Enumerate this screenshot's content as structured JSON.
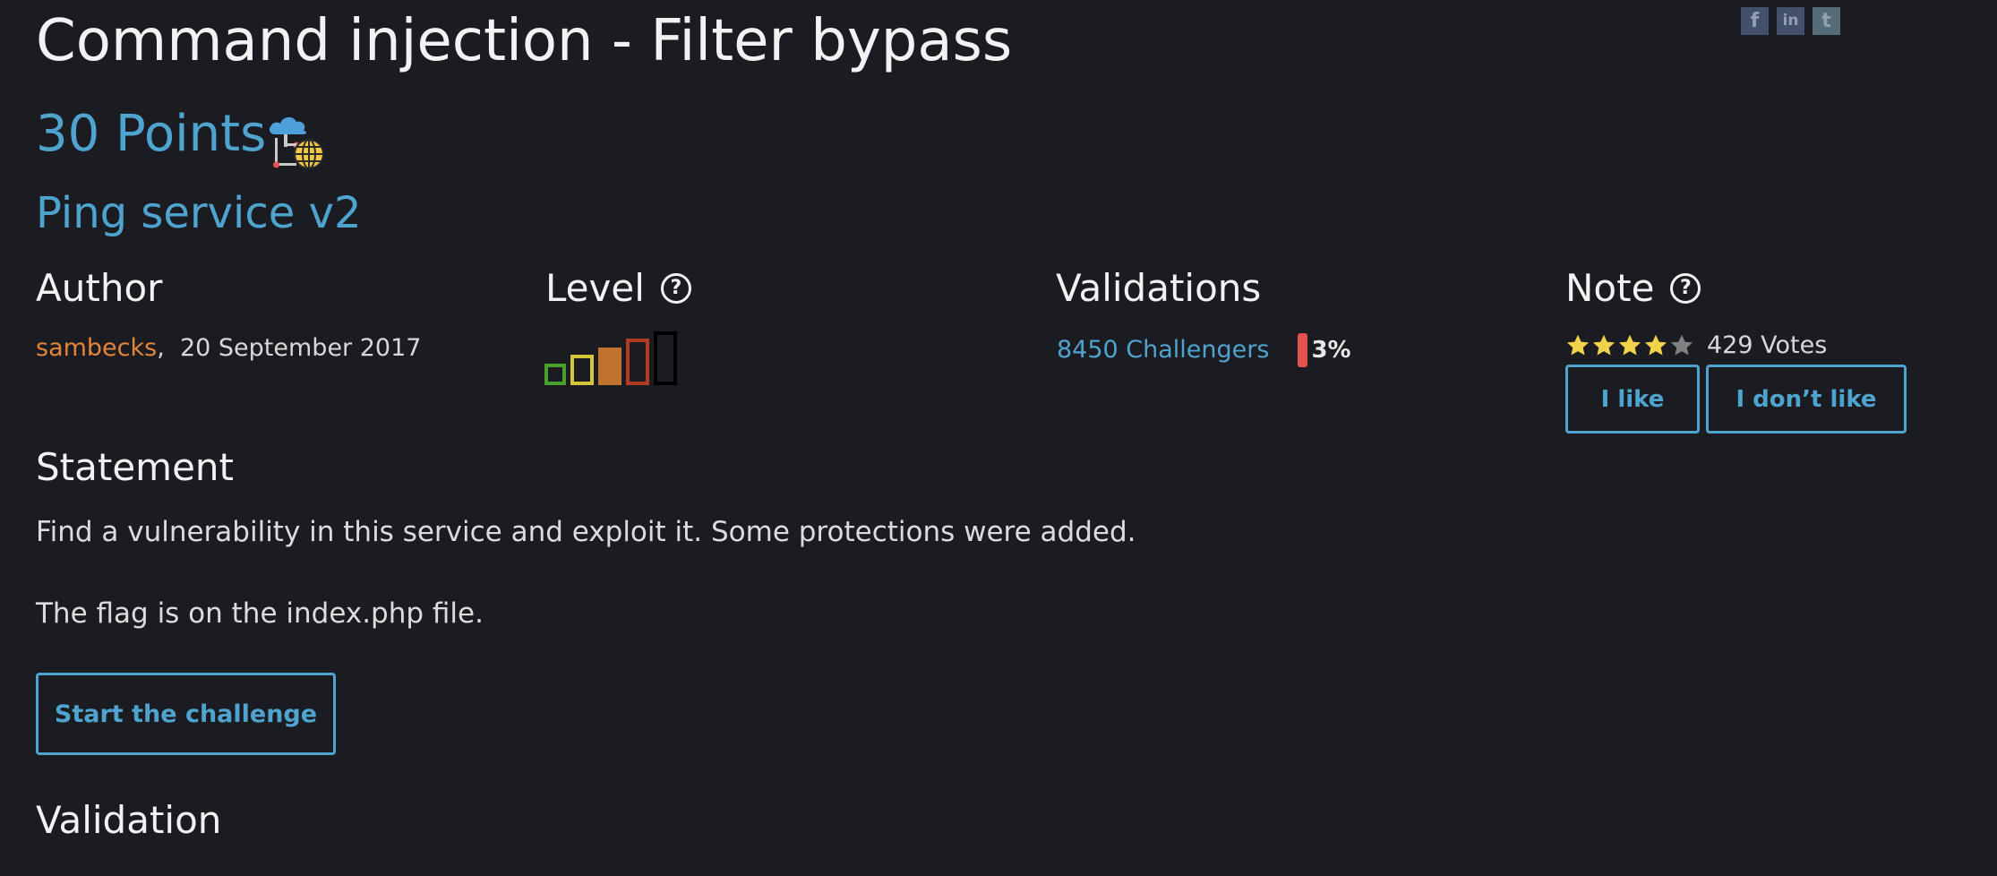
{
  "challenge": {
    "title": "Command injection - Filter bypass",
    "points": "30 Points",
    "subtitle": "Ping service v2",
    "category_icon": "cloud-network-globe-icon"
  },
  "share": {
    "icons": [
      "facebook-icon",
      "linkedin-icon",
      "twitter-icon"
    ],
    "facebook_glyph": "f",
    "linkedin_glyph": "in",
    "twitter_glyph": "t"
  },
  "author": {
    "heading": "Author",
    "name": "sambecks",
    "separator": ",",
    "date": "20 September 2017"
  },
  "level": {
    "heading": "Level",
    "help_glyph": "?",
    "current_level": 3,
    "max_level": 5,
    "colors": [
      "#4aa02c",
      "#d3c63b",
      "#c0742f",
      "#b23a22",
      "#000000"
    ]
  },
  "validations": {
    "heading": "Validations",
    "challengers": "8450 Challengers",
    "percent": "3%",
    "percent_value": 3,
    "bar_color": "#e5514e"
  },
  "note": {
    "heading": "Note",
    "help_glyph": "?",
    "rating": 4,
    "rating_max": 5,
    "votes": "429 Votes",
    "star_color": "#f2d24b",
    "star_empty_color": "#808080",
    "like_label": "I like",
    "dislike_label": "I don’t like"
  },
  "statement": {
    "heading": "Statement",
    "line1": "Find a vulnerability in this service and exploit it. Some protections were added.",
    "line2": "The flag is on the index.php file.",
    "start_label": "Start the challenge"
  },
  "validation_section": {
    "heading": "Validation"
  },
  "colors": {
    "background": "#1b1c21",
    "accent": "#4fa3cf",
    "author_link": "#e2853a"
  }
}
